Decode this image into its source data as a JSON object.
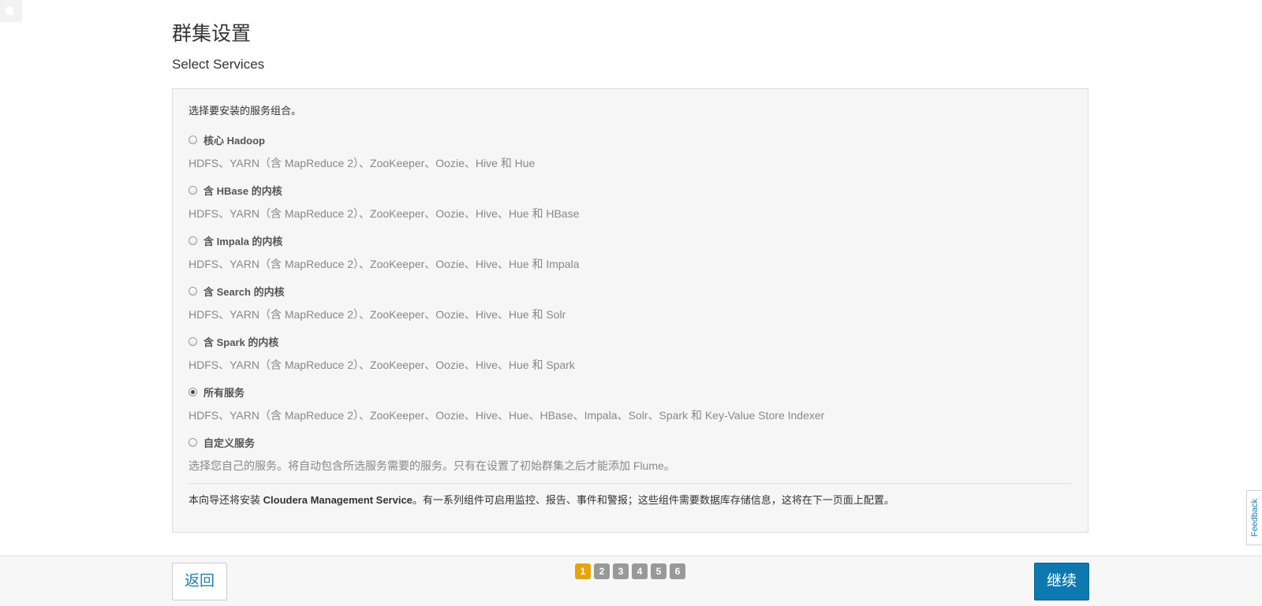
{
  "page": {
    "title": "群集设置",
    "section": "Select Services"
  },
  "panel": {
    "intro": "选择要安装的服务组合。",
    "options": [
      {
        "label": "核心 Hadoop",
        "desc": "HDFS、YARN（含 MapReduce 2）、ZooKeeper、Oozie、Hive 和 Hue",
        "checked": false
      },
      {
        "label": "含 HBase 的内核",
        "desc": "HDFS、YARN（含 MapReduce 2）、ZooKeeper、Oozie、Hive、Hue 和 HBase",
        "checked": false
      },
      {
        "label": "含 Impala 的内核",
        "desc": "HDFS、YARN（含 MapReduce 2）、ZooKeeper、Oozie、Hive、Hue 和 Impala",
        "checked": false
      },
      {
        "label": "含 Search 的内核",
        "desc": "HDFS、YARN（含 MapReduce 2）、ZooKeeper、Oozie、Hive、Hue 和 Solr",
        "checked": false
      },
      {
        "label": "含 Spark 的内核",
        "desc": "HDFS、YARN（含 MapReduce 2）、ZooKeeper、Oozie、Hive、Hue 和 Spark",
        "checked": false
      },
      {
        "label": "所有服务",
        "desc": "HDFS、YARN（含 MapReduce 2）、ZooKeeper、Oozie、Hive、Hue、HBase、Impala、Solr、Spark 和 Key-Value Store Indexer",
        "checked": true
      },
      {
        "label": "自定义服务",
        "desc": "选择您自己的服务。将自动包含所选服务需要的服务。只有在设置了初始群集之后才能添加 Flume。",
        "checked": false
      }
    ],
    "note_prefix": "本向导还将安装 ",
    "note_bold": "Cloudera Management Service",
    "note_suffix": "。有一系列组件可启用监控、报告、事件和警报；这些组件需要数据库存储信息，这将在下一页面上配置。"
  },
  "footer": {
    "back_label": "返回",
    "continue_label": "继续",
    "steps": [
      "1",
      "2",
      "3",
      "4",
      "5",
      "6"
    ],
    "active_step": "1"
  },
  "feedback_label": "Feedback",
  "colors": {
    "accent": "#0e79b0",
    "step_active": "#e8a30c",
    "step_inactive": "#999999"
  }
}
